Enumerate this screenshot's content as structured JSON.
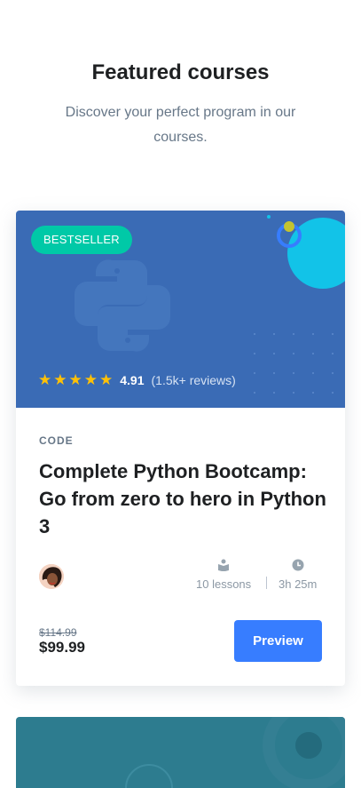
{
  "section": {
    "title": "Featured courses",
    "subtitle": "Discover your perfect program in our courses."
  },
  "course": {
    "badge": "BESTSELLER",
    "rating": {
      "stars": 5,
      "score": "4.91",
      "reviews": "(1.5k+ reviews)"
    },
    "category": "CODE",
    "title": "Complete Python Bootcamp: Go from zero to hero in Python 3",
    "meta": {
      "lessons": "10 lessons",
      "duration": "3h 25m",
      "lessons_icon": "book-icon",
      "duration_icon": "clock-icon"
    },
    "old_price": "$114.99",
    "price": "$99.99",
    "button": "Preview"
  },
  "colors": {
    "banner": "#3a6bb5",
    "badge": "#00c9a7",
    "primary_button": "#377dff",
    "star": "#ffc107",
    "second_card": "#2d7c8f"
  }
}
